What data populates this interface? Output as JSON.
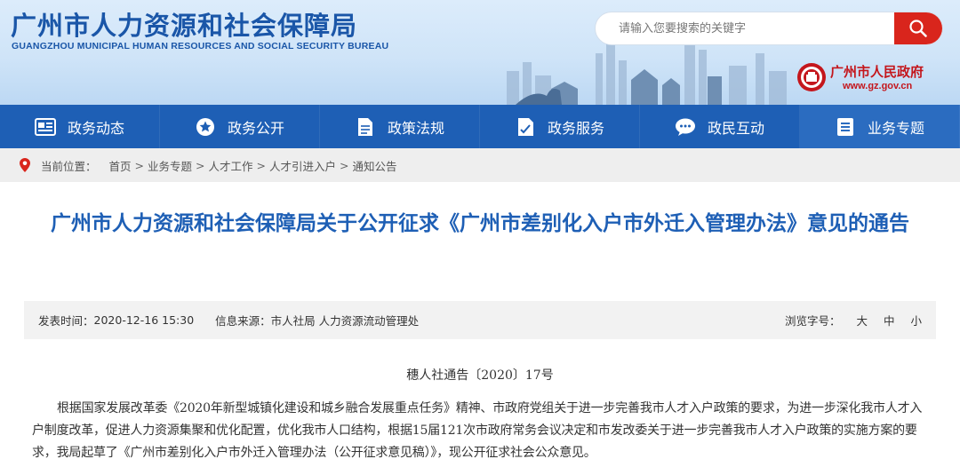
{
  "header": {
    "title": "广州市人力资源和社会保障局",
    "subtitle": "GUANGZHOU MUNICIPAL HUMAN RESOURCES AND SOCIAL SECURITY BUREAU",
    "search_placeholder": "请输入您要搜索的关键字",
    "gov_name": "广州市人民政府",
    "gov_url": "www.gz.gov.cn"
  },
  "nav": {
    "items": [
      {
        "label": "政务动态",
        "icon": "news-icon"
      },
      {
        "label": "政务公开",
        "icon": "star-badge-icon"
      },
      {
        "label": "政策法规",
        "icon": "document-icon"
      },
      {
        "label": "政务服务",
        "icon": "service-icon"
      },
      {
        "label": "政民互动",
        "icon": "chat-icon"
      },
      {
        "label": "业务专题",
        "icon": "list-icon"
      }
    ]
  },
  "breadcrumb": {
    "label": "当前位置：",
    "items": [
      "首页",
      "业务专题",
      "人才工作",
      "人才引进入户",
      "通知公告"
    ],
    "separator": ">"
  },
  "article": {
    "title": "广州市人力资源和社会保障局关于公开征求《广州市差别化入户市外迁入管理办法》意见的通告",
    "publish_label": "发表时间：",
    "publish_time": "2020-12-16 15:30",
    "source_label": "信息来源：",
    "source": "市人社局 人力资源流动管理处",
    "fontsize_label": "浏览字号：",
    "fontsize_options": [
      "大",
      "中",
      "小"
    ],
    "doc_number": "穗人社通告〔2020〕17号",
    "paragraph": "根据国家发展改革委《2020年新型城镇化建设和城乡融合发展重点任务》精神、市政府党组关于进一步完善我市人才入户政策的要求，为进一步深化我市人才入户制度改革，促进人力资源集聚和优化配置，优化我市人口结构，根据15届121次市政府常务会议决定和市发改委关于进一步完善我市人才入户政策的实施方案的要求，我局起草了《广州市差别化入户市外迁入管理办法（公开征求意见稿）》，现公开征求社会公众意见。"
  },
  "colors": {
    "nav_bg": "#1e5fb5",
    "title_blue": "#1e5fb5",
    "search_red": "#d9251c",
    "gov_red": "#c4161c"
  }
}
